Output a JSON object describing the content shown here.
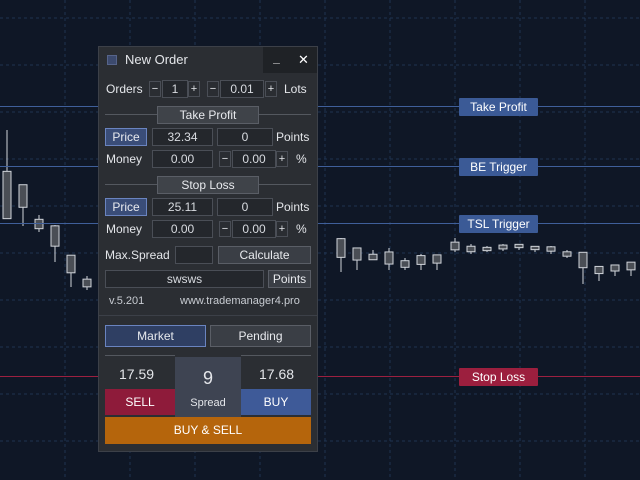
{
  "window": {
    "title": "New Order",
    "minimize_glyph": "_",
    "close_glyph": "✕"
  },
  "orders": {
    "label": "Orders",
    "count": "1",
    "lots_value": "0.01",
    "lots_label": "Lots",
    "minus": "−",
    "plus": "+"
  },
  "take_profit": {
    "header": "Take Profit",
    "price_label": "Price",
    "price_value": "32.34",
    "points_value": "0",
    "points_label": "Points",
    "money_label": "Money",
    "money_value": "0.00",
    "percent_value": "0.00",
    "percent_label": "%"
  },
  "stop_loss": {
    "header": "Stop Loss",
    "price_label": "Price",
    "price_value": "25.11",
    "points_value": "0",
    "points_label": "Points",
    "money_label": "Money",
    "money_value": "0.00",
    "percent_value": "0.00",
    "percent_label": "%"
  },
  "spread_row": {
    "label": "Max.Spread",
    "value": "",
    "calculate": "Calculate"
  },
  "comment": {
    "value": "swsws",
    "points_button": "Points"
  },
  "footer": {
    "version": "v.5.201",
    "website": "www.trademanager4.pro"
  },
  "tabs": [
    {
      "label": "Market",
      "active": true
    },
    {
      "label": "Pending",
      "active": false
    }
  ],
  "trade": {
    "sell_price": "17.59",
    "buy_price": "17.68",
    "spread_value": "9",
    "spread_label": "Spread",
    "sell_label": "SELL",
    "buy_label": "BUY",
    "buy_sell_label": "BUY & SELL"
  },
  "chart_tags": {
    "take_profit": "Take Profit",
    "be_trigger": "BE Trigger",
    "tsl_trigger": "TSL Trigger",
    "stop_loss": "Stop Loss"
  },
  "colors": {
    "background": "#0f1726",
    "grid": "#1f3350",
    "level_line": "#3f5f9a",
    "tag_blue": "#3b5a96",
    "stop_line": "#9c2040",
    "tag_red": "#9c1f3e",
    "sell": "#8e1b3a",
    "buy": "#3e5a98",
    "buy_sell": "#b5650c"
  }
}
